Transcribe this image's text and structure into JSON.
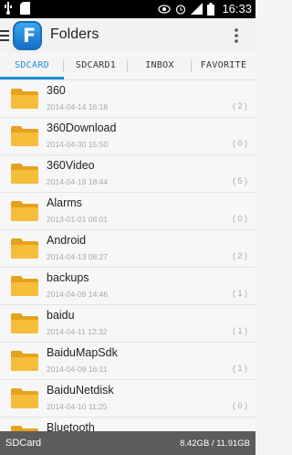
{
  "status_bar": {
    "time": "16:33"
  },
  "action_bar": {
    "logo_letter": "F",
    "title": "Folders"
  },
  "tabs": [
    {
      "label": "SDCARD",
      "active": true
    },
    {
      "label": "SDCARD1",
      "active": false
    },
    {
      "label": "INBOX",
      "active": false
    },
    {
      "label": "FAVORITE",
      "active": false
    }
  ],
  "folders": [
    {
      "name": "360",
      "date": "2014-04-14 16:18",
      "count": "( 2 )"
    },
    {
      "name": "360Download",
      "date": "2014-04-30 15:50",
      "count": "( 0 )"
    },
    {
      "name": "360Video",
      "date": "2014-04-19 18:44",
      "count": "( 5 )"
    },
    {
      "name": "Alarms",
      "date": "2013-01-01 08:01",
      "count": "( 0 )"
    },
    {
      "name": "Android",
      "date": "2014-04-13 08:27",
      "count": "( 2 )"
    },
    {
      "name": "backups",
      "date": "2014-04-09 14:46",
      "count": "( 1 )"
    },
    {
      "name": "baidu",
      "date": "2014-04-11 12:32",
      "count": "( 1 )"
    },
    {
      "name": "BaiduMapSdk",
      "date": "2014-04-09 16:11",
      "count": "( 1 )"
    },
    {
      "name": "BaiduNetdisk",
      "date": "2014-04-10 11:25",
      "count": "( 0 )"
    },
    {
      "name": "Bluetooth",
      "date": "",
      "count": ""
    }
  ],
  "storage": {
    "label": "SDCard",
    "size": "8.42GB / 11.91GB"
  },
  "colors": {
    "accent": "#1e8fd8",
    "folder": "#f2b32a",
    "storage_bar": "#5c5c5c"
  }
}
